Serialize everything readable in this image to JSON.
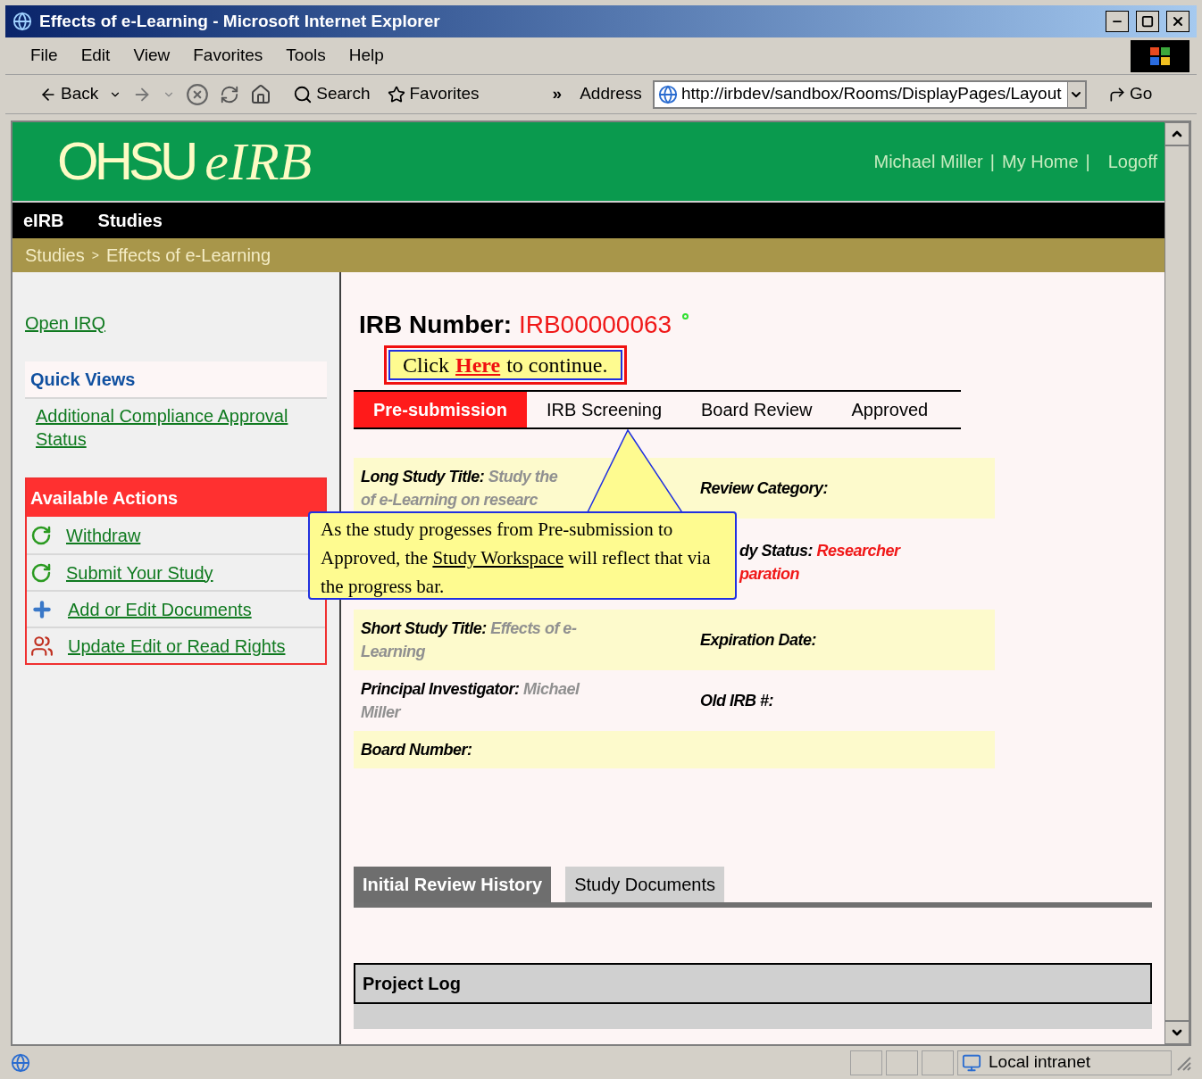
{
  "window": {
    "title": "Effects of e-Learning - Microsoft Internet Explorer"
  },
  "menu": [
    "File",
    "Edit",
    "View",
    "Favorites",
    "Tools",
    "Help"
  ],
  "toolbar": {
    "back": "Back",
    "search": "Search",
    "favorites": "Favorites",
    "more": "»",
    "address_label": "Address",
    "url": "http://irbdev/sandbox/Rooms/DisplayPages/Layout",
    "go": "Go"
  },
  "header": {
    "logo_main": "OHSU",
    "logo_sub": "eIRB",
    "links": [
      "Michael Miller",
      "My Home",
      "Logoff"
    ],
    "separator": "|"
  },
  "nav": [
    "eIRB",
    "Studies"
  ],
  "breadcrumb": {
    "items": [
      "Studies",
      "Effects of e-Learning"
    ],
    "separator": ">"
  },
  "sidebar": {
    "open_link": "Open IRQ",
    "quick_views": {
      "title": "Quick Views",
      "items": [
        "Additional Compliance Approval Status"
      ]
    },
    "actions": {
      "title": "Available Actions",
      "items": [
        {
          "kind": "cycle",
          "label": "Withdraw"
        },
        {
          "kind": "cycle",
          "label": "Submit Your Study"
        },
        {
          "kind": "plus",
          "label": "Add or Edit Documents"
        },
        {
          "kind": "people",
          "label": "Update Edit or Read Rights"
        }
      ]
    }
  },
  "main": {
    "irb_label": "IRB Number:",
    "irb_number": "IRB00000063",
    "prompt": {
      "before": "Click",
      "link": "Here",
      "after": "to continue."
    },
    "progress": [
      {
        "label": "Pre-submission",
        "selected": true
      },
      {
        "label": "IRB Screening",
        "selected": false
      },
      {
        "label": "Board Review",
        "selected": false
      },
      {
        "label": "Approved",
        "selected": false
      }
    ],
    "fields": [
      [
        {
          "label": "Long Study Title:",
          "value": [
            "Study the",
            "of e-Learning on researc"
          ],
          "kind": "text"
        },
        {
          "label": "Review Category:",
          "kind": "text"
        }
      ],
      [
        {
          "kind": "empty"
        },
        {
          "label": "dy Status:",
          "value": [
            "Researcher",
            "paration"
          ],
          "kind": "status"
        }
      ],
      [
        {
          "label": "Short Study Title:",
          "value": [
            "Effects of e-",
            "Learning"
          ],
          "kind": "text"
        },
        {
          "label": "Expiration Date:",
          "kind": "text"
        }
      ],
      [
        {
          "label": "Principal Investigator:",
          "value": [
            "Michael",
            "Miller"
          ],
          "kind": "text"
        },
        {
          "label": "Old IRB #:",
          "kind": "text"
        }
      ],
      [
        {
          "label": "Board Number:",
          "kind": "text"
        }
      ]
    ],
    "callout": {
      "before": "As the study progesses from Pre-submission to Approved, the",
      "link": "Study Workspace",
      "after": "will reflect that via the progress bar."
    },
    "tabs": [
      {
        "label": "Initial Review History",
        "selected": true
      },
      {
        "label": "Study Documents",
        "selected": false
      }
    ],
    "project_log": "Project Log"
  },
  "status_bar": {
    "zone": "Local intranet"
  }
}
